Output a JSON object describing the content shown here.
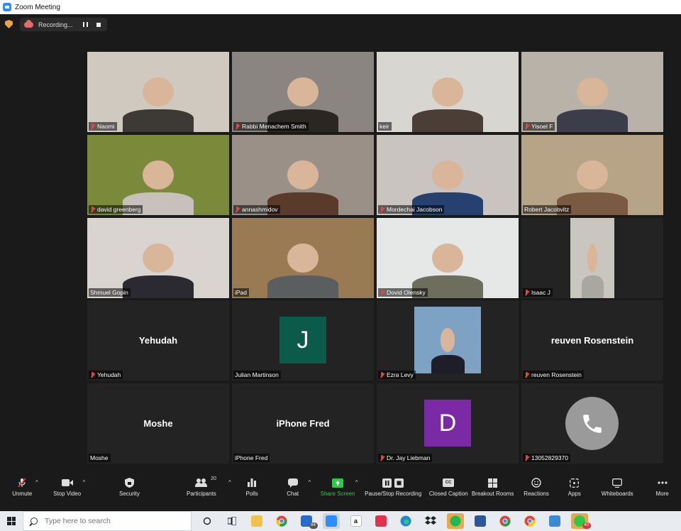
{
  "window": {
    "title": "Zoom Meeting"
  },
  "recording": {
    "label": "Recording..."
  },
  "participants": [
    {
      "name": "Naomi",
      "muted": true,
      "type": "video",
      "bg": "#cfc9c0",
      "fg": "#3d3a36"
    },
    {
      "name": "Rabbi Menachem Smith",
      "muted": true,
      "type": "video",
      "bg": "#8a8580",
      "fg": "#2a2622"
    },
    {
      "name": "keir",
      "muted": false,
      "type": "video",
      "bg": "#d8d6d1",
      "fg": "#4a3e36"
    },
    {
      "name": "Yisoel F",
      "muted": true,
      "type": "video",
      "bg": "#b9b2a8",
      "fg": "#3b3d4a"
    },
    {
      "name": "david greenberg",
      "muted": true,
      "type": "video",
      "bg": "#7a8a3a",
      "fg": "#c8c0bb"
    },
    {
      "name": "annashmidov",
      "muted": true,
      "type": "video",
      "bg": "#9a9088",
      "fg": "#5a3a2a"
    },
    {
      "name": "Mordechai Jacobson",
      "muted": true,
      "type": "video",
      "bg": "#c9c4c0",
      "fg": "#24416f"
    },
    {
      "name": "Robert Jacobvitz",
      "muted": false,
      "type": "video",
      "bg": "#b7a487",
      "fg": "#7a5a40"
    },
    {
      "name": "Shmuel Gopin",
      "muted": false,
      "type": "video",
      "bg": "#d9d4cf",
      "fg": "#2a2a30"
    },
    {
      "name": "iPad",
      "muted": false,
      "type": "video",
      "bg": "#9a7a52",
      "fg": "#5a5e5e",
      "active": true
    },
    {
      "name": "Dovid Olensky",
      "muted": true,
      "type": "video",
      "bg": "#e6e8e8",
      "fg": "#6e6e5e"
    },
    {
      "name": "Isaac J",
      "muted": true,
      "type": "video",
      "bg": "#232323",
      "fg": "#a8a8a0"
    },
    {
      "name": "Yehudah",
      "muted": true,
      "type": "name",
      "display": "Yehudah"
    },
    {
      "name": "Julian Martinson",
      "muted": false,
      "type": "avatar",
      "letter": "J",
      "color": "#0b5a4a"
    },
    {
      "name": "Ezra Levy",
      "muted": true,
      "type": "photo",
      "bg": "#7da2c4",
      "fg": "#1e1e2a"
    },
    {
      "name": "reuven Rosenstein",
      "muted": true,
      "type": "name",
      "display": "reuven Rosenstein"
    },
    {
      "name": "Moshe",
      "muted": false,
      "type": "name",
      "display": "Moshe"
    },
    {
      "name": "iPhone Fred",
      "muted": false,
      "type": "name",
      "display": "iPhone Fred"
    },
    {
      "name": "Dr. Jay Liebman",
      "muted": true,
      "type": "avatar",
      "letter": "D",
      "color": "#7b2aa6"
    },
    {
      "name": "13052829370",
      "muted": true,
      "type": "phone"
    }
  ],
  "toolbar": {
    "unmute": "Unmute",
    "stop_video": "Stop Video",
    "security": "Security",
    "participants": "Participants",
    "participants_count": "20",
    "polls": "Polls",
    "chat": "Chat",
    "share_screen": "Share Screen",
    "pause_stop_recording": "Pause/Stop Recording",
    "closed_caption": "Closed Caption",
    "cc": "CC",
    "breakout_rooms": "Breakout Rooms",
    "reactions": "Reactions",
    "apps": "Apps",
    "whiteboards": "Whiteboards",
    "more": "More"
  },
  "taskbar": {
    "search_placeholder": "Type here to search",
    "mail_badge": "84",
    "notif_badge": "40",
    "app_letter_a": "a"
  },
  "colors": {
    "accent_green": "#2ec84a",
    "active_speaker": "#c9e24a",
    "muted_red": "#e64545"
  }
}
